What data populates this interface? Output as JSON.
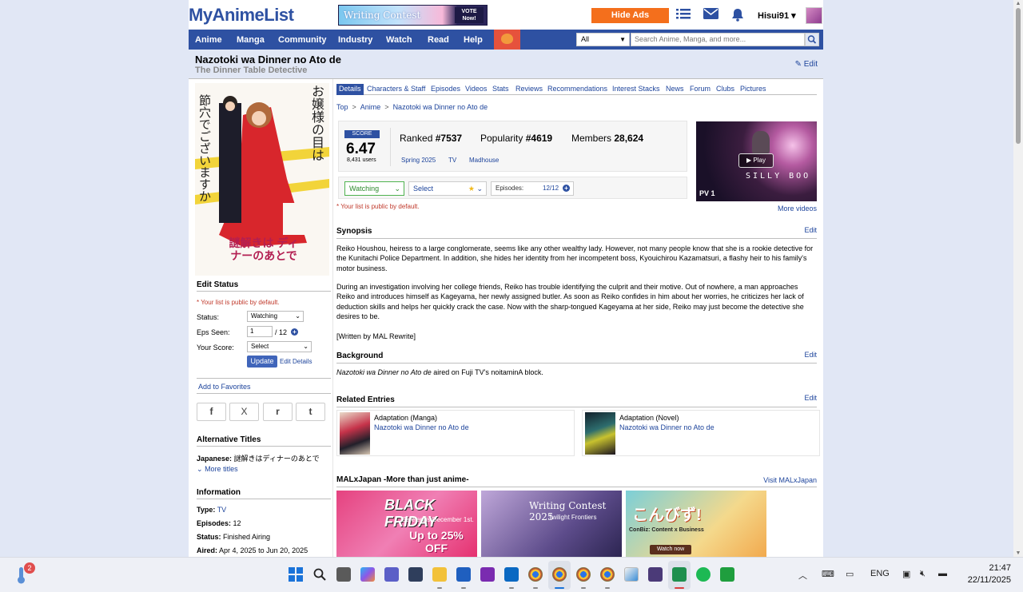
{
  "header": {
    "logo": "MyAnimeList",
    "banner_text": "Writing Contest",
    "banner_vote": "VOTE Now!",
    "hide_ads": "Hide Ads",
    "username": "Hisui91 ▾"
  },
  "nav": {
    "items": [
      "Anime",
      "Manga",
      "Community",
      "Industry",
      "Watch",
      "Read",
      "Help"
    ],
    "search_scope": "All",
    "search_placeholder": "Search Anime, Manga, and more..."
  },
  "title": {
    "main": "Nazotoki wa Dinner no Ato de",
    "english": "The Dinner Table Detective",
    "edit": "Edit"
  },
  "left": {
    "edit_status_head": "Edit Status",
    "public_note": "* Your list is public by default.",
    "status_label": "Status:",
    "status_value": "Watching",
    "eps_label": "Eps Seen:",
    "eps_value": "1",
    "eps_total": "/ 12",
    "score_label": "Your Score:",
    "score_value": "Select",
    "update": "Update",
    "edit_details": "Edit Details",
    "add_favorites": "Add to Favorites",
    "share": [
      "f",
      "X",
      "r",
      "t"
    ],
    "alt_titles_head": "Alternative Titles",
    "japanese_label": "Japanese:",
    "japanese_value": "謎解きはディナーのあとで",
    "more_titles": "More titles",
    "info_head": "Information",
    "info": [
      {
        "label": "Type:",
        "value": "TV",
        "link": true
      },
      {
        "label": "Episodes:",
        "value": "12",
        "link": false
      },
      {
        "label": "Status:",
        "value": "Finished Airing",
        "link": false
      },
      {
        "label": "Aired:",
        "value": "Apr 4, 2025 to Jun 20, 2025",
        "link": false
      }
    ],
    "poster_text_a": "お嬢様の目は",
    "poster_text_b": "節穴でございますか",
    "poster_logo": "謎解きは ディナーのあとで"
  },
  "tabs": [
    "Details",
    "Characters & Staff",
    "Episodes",
    "Videos",
    "Stats",
    "Reviews",
    "Recommendations",
    "Interest Stacks",
    "News",
    "Forum",
    "Clubs",
    "Pictures"
  ],
  "breadcrumb": [
    "Top",
    "Anime",
    "Nazotoki wa Dinner no Ato de"
  ],
  "stats": {
    "score_label": "SCORE",
    "score": "6.47",
    "users": "8,431 users",
    "ranked_label": "Ranked",
    "ranked": "#7537",
    "popularity_label": "Popularity",
    "popularity": "#4619",
    "members_label": "Members",
    "members": "28,624",
    "season": "Spring 2025",
    "type": "TV",
    "studio": "Madhouse"
  },
  "video": {
    "play": "Play",
    "label": "PV 1",
    "overlay": "SILLY BOO",
    "more": "More videos"
  },
  "listbar": {
    "status": "Watching",
    "score": "Select",
    "episodes_label": "Episodes:",
    "episodes_value": "12/12",
    "public_note": "* Your list is public by default."
  },
  "synopsis": {
    "head": "Synopsis",
    "edit": "Edit",
    "p1": "Reiko Houshou, heiress to a large conglomerate, seems like any other wealthy lady. However, not many people know that she is a rookie detective for the Kunitachi Police Department. In addition, she hides her identity from her incompetent boss, Kyouichirou Kazamatsuri, a flashy heir to his family's motor business.",
    "p2": "During an investigation involving her college friends, Reiko has trouble identifying the culprit and their motive. Out of nowhere, a man approaches Reiko and introduces himself as Kageyama, her newly assigned butler. As soon as Reiko confides in him about her worries, he criticizes her lack of deduction skills and helps her quickly crack the case. Now with the sharp-tongued Kageyama at her side, Reiko may just become the detective she desires to be.",
    "p3": "[Written by MAL Rewrite]"
  },
  "background": {
    "head": "Background",
    "edit": "Edit",
    "title_italic": "Nazotoki wa Dinner no Ato de",
    "text": " aired on Fuji TV's noitaminA block."
  },
  "related": {
    "head": "Related Entries",
    "edit": "Edit",
    "items": [
      {
        "type": "Adaptation (Manga)",
        "name": "Nazotoki wa Dinner no Ato de"
      },
      {
        "type": "Adaptation (Novel)",
        "name": "Nazotoki wa Dinner no Ato de"
      }
    ]
  },
  "maljapan": {
    "head": "MALxJapan -More than just anime-",
    "visit": "Visit MALxJapan",
    "cards": [
      {
        "title": "BLACK FRIDAY",
        "sub": "Sale ends December 1st.",
        "offer": "Up to 25% OFF"
      },
      {
        "title": "Writing Contest 2025",
        "sub": "Twilight Frontiers"
      },
      {
        "title": "こんびず!",
        "sub": "ConBiz: Content x Business",
        "cta": "Watch now"
      }
    ]
  },
  "taskbar": {
    "weather_badge": "2",
    "language": "ENG",
    "time": "21:47",
    "date": "22/11/2025"
  },
  "colors": {
    "mal_blue": "#2e51a2",
    "hide_ads_orange": "#f46f1c",
    "page_bg": "#e1e7f5"
  }
}
